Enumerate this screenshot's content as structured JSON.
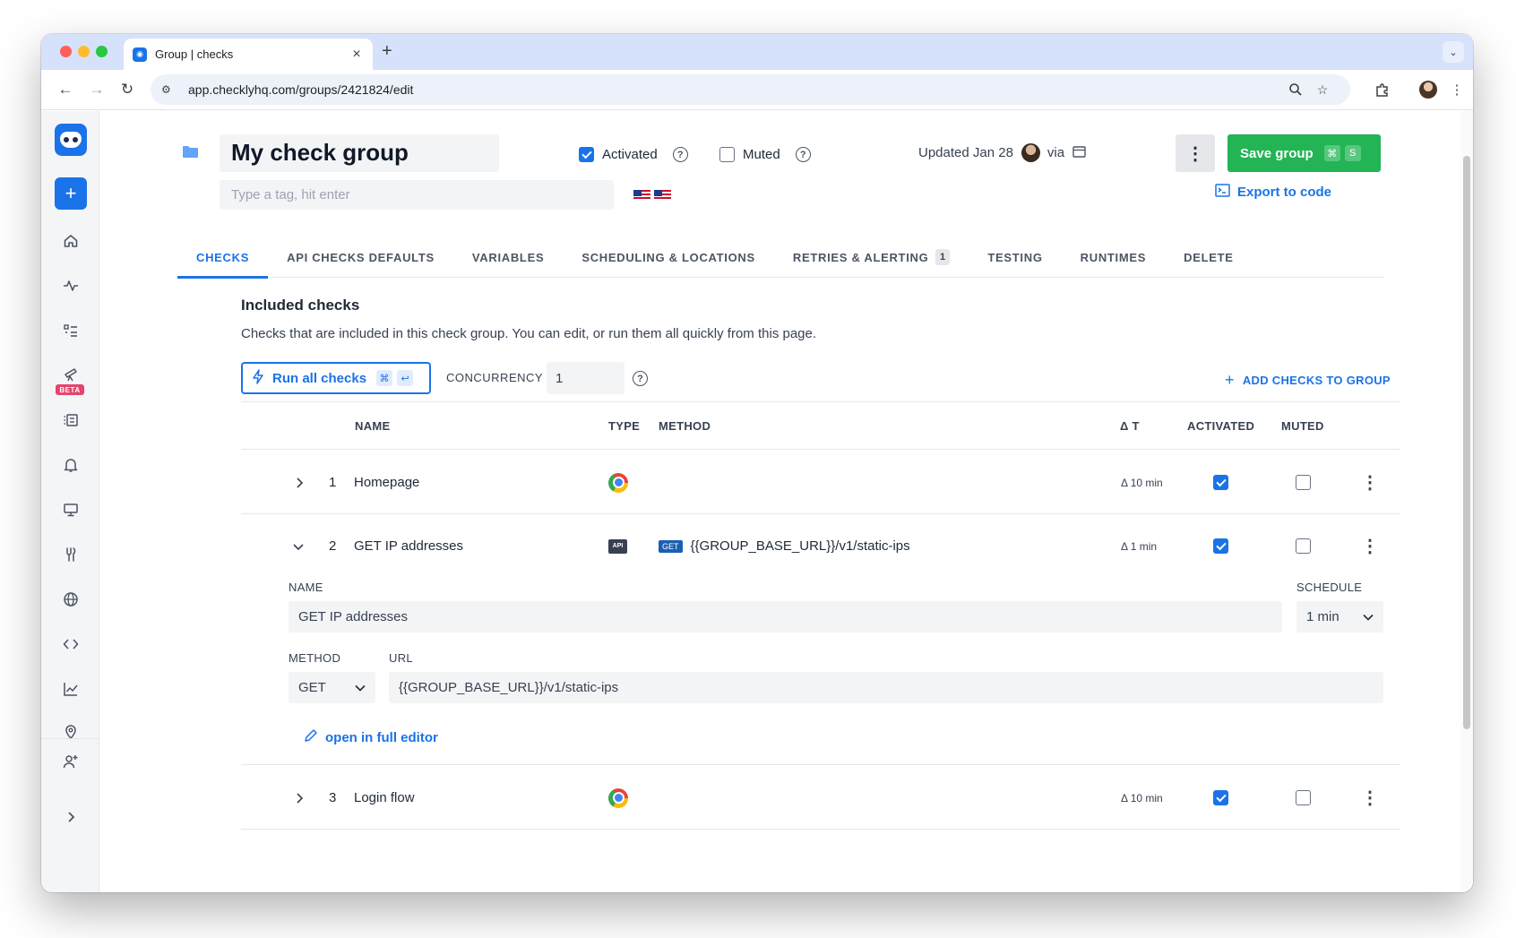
{
  "browser": {
    "tab_title": "Group | checks",
    "url": "app.checklyhq.com/groups/2421824/edit"
  },
  "sidebar": {
    "beta_label": "BETA"
  },
  "header": {
    "group_name": "My check group",
    "activated_label": "Activated",
    "activated": true,
    "muted_label": "Muted",
    "muted": false,
    "updated_text": "Updated Jan 28",
    "via_text": "via",
    "save_label": "Save group",
    "save_shortcut_keys": [
      "⌘",
      "S"
    ],
    "export_label": "Export to code",
    "tag_placeholder": "Type a tag, hit enter"
  },
  "tabs": [
    {
      "label": "CHECKS",
      "active": true
    },
    {
      "label": "API CHECKS DEFAULTS"
    },
    {
      "label": "VARIABLES"
    },
    {
      "label": "SCHEDULING & LOCATIONS"
    },
    {
      "label": "RETRIES & ALERTING",
      "badge": "1"
    },
    {
      "label": "TESTING"
    },
    {
      "label": "RUNTIMES"
    },
    {
      "label": "DELETE"
    }
  ],
  "section": {
    "title": "Included checks",
    "description": "Checks that are included in this check group. You can edit, or run them all quickly from this page.",
    "run_all_label": "Run all checks",
    "run_all_keys": [
      "⌘",
      "↩"
    ],
    "concurrency_label": "CONCURRENCY",
    "concurrency_value": "1",
    "add_checks_label": "ADD CHECKS TO GROUP"
  },
  "table": {
    "columns": {
      "name": "NAME",
      "type": "TYPE",
      "method": "METHOD",
      "delta": "Δ T",
      "activated": "ACTIVATED",
      "muted": "MUTED"
    },
    "rows": [
      {
        "index": "1",
        "name": "Homepage",
        "type": "browser",
        "method": "",
        "url": "",
        "delta": "Δ 10 min",
        "activated": true,
        "muted": false,
        "expanded": false
      },
      {
        "index": "2",
        "name": "GET IP addresses",
        "type": "api",
        "type_label": "API",
        "method": "GET",
        "url": "{{GROUP_BASE_URL}}/v1/static-ips",
        "delta": "Δ 1 min",
        "activated": true,
        "muted": false,
        "expanded": true
      },
      {
        "index": "3",
        "name": "Login flow",
        "type": "browser",
        "method": "",
        "url": "",
        "delta": "Δ 10 min",
        "activated": true,
        "muted": false,
        "expanded": false
      }
    ]
  },
  "expanded_check": {
    "name_label": "NAME",
    "name_value": "GET IP addresses",
    "schedule_label": "SCHEDULE",
    "schedule_value": "1 min",
    "method_label": "METHOD",
    "method_value": "GET",
    "url_label": "URL",
    "url_value": "{{GROUP_BASE_URL}}/v1/static-ips",
    "open_editor_label": "open in full editor"
  },
  "colors": {
    "accent": "#1a73e8",
    "save_green": "#22b455",
    "beta_pink": "#e5446d"
  }
}
